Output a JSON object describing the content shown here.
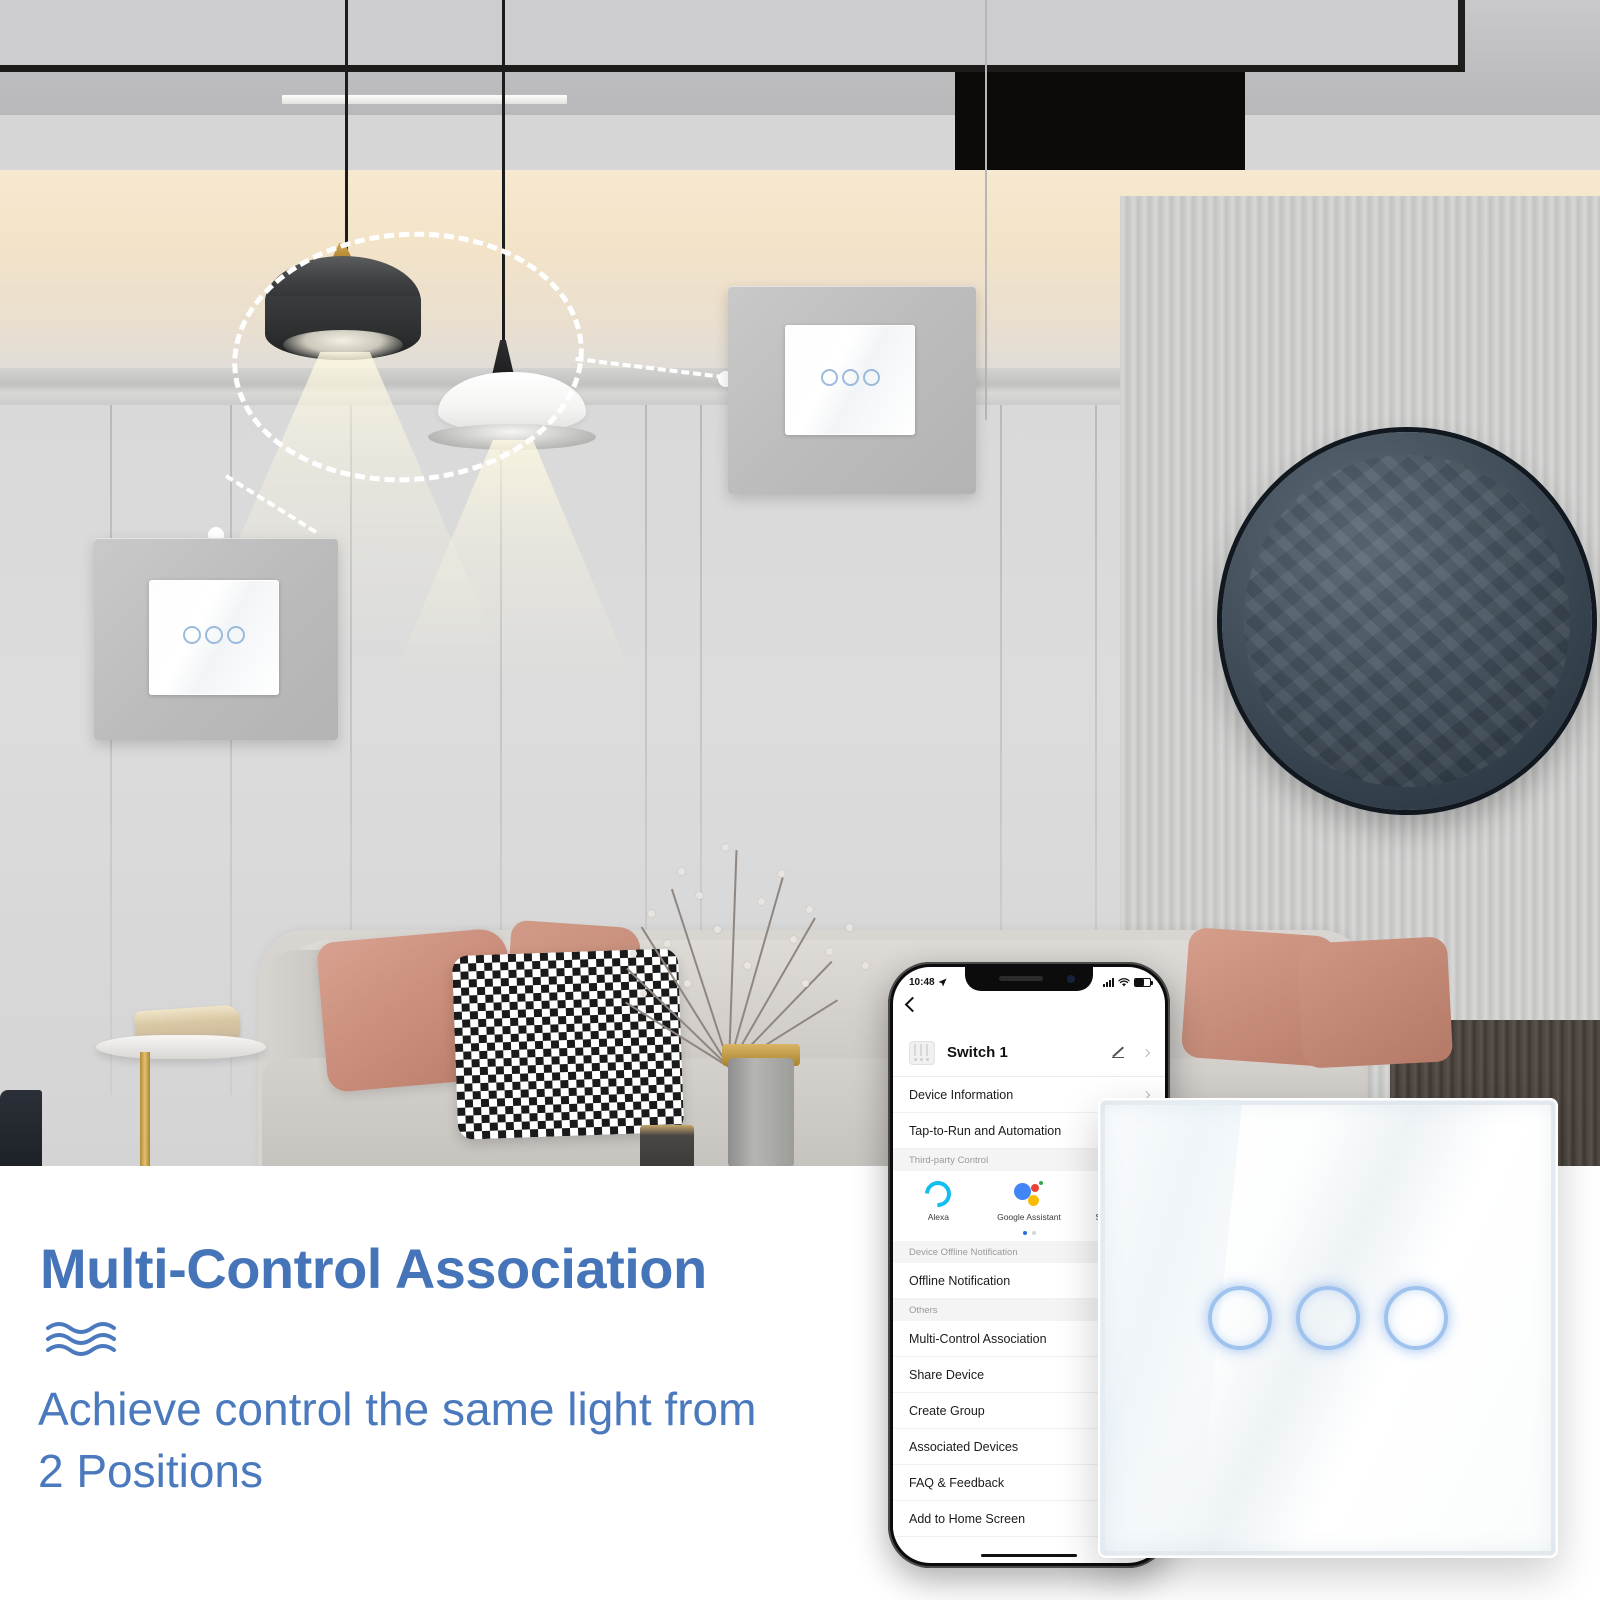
{
  "marketing": {
    "headline": "Multi-Control Association",
    "subline_1": "Achieve control the same light from",
    "subline_2": "2 Positions",
    "accent_color": "#4574b8",
    "sub_color": "#4b79bd",
    "divider_icon": "wave-lines-icon"
  },
  "phone": {
    "status": {
      "time": "10:48",
      "location_icon": "location-arrow-icon",
      "signal_icon": "cellular-bars-icon",
      "wifi_icon": "wifi-icon",
      "battery_icon": "battery-icon"
    },
    "nav": {
      "back_icon": "back-chevron-icon"
    },
    "device": {
      "icon": "switch-device-icon",
      "name": "Switch 1",
      "edit_icon": "pencil-icon",
      "chevron_icon": "chevron-right-icon"
    },
    "sections": [
      {
        "group_label": "",
        "rows": [
          {
            "label": "Device Information"
          },
          {
            "label": "Tap-to-Run and Automation"
          }
        ]
      },
      {
        "group_label": "Third-party Control",
        "rows": []
      },
      {
        "group_label": "Device Offline Notification",
        "rows": [
          {
            "label": "Offline Notification"
          }
        ]
      },
      {
        "group_label": "Others",
        "rows": [
          {
            "label": "Multi-Control Association"
          },
          {
            "label": "Share Device"
          },
          {
            "label": "Create Group"
          },
          {
            "label": "Associated Devices"
          },
          {
            "label": "FAQ & Feedback"
          },
          {
            "label": "Add to Home Screen"
          }
        ]
      }
    ],
    "third_party": [
      {
        "label": "Alexa",
        "icon": "alexa-icon",
        "color": "#12bdf0"
      },
      {
        "label": "Google Assistant",
        "icon": "google-assistant-icon",
        "color": "#4285f4"
      },
      {
        "label": "SmartThings",
        "icon": "smartthings-icon",
        "color": "#1a9fe0"
      }
    ],
    "carousel": {
      "pages": 2,
      "active": 1,
      "active_color": "#2a6fd6"
    }
  },
  "product": {
    "name": "glass-touch-switch-panel",
    "button_count": 3,
    "led_ring_color": "#9fc3ee",
    "panel_color": "#ffffff"
  },
  "scene": {
    "wall_switches": [
      {
        "name": "wall-switch-top-right",
        "buttons": 3
      },
      {
        "name": "wall-switch-bottom-left",
        "buttons": 3
      }
    ],
    "lamps": [
      {
        "name": "pendant-lamp-dark"
      },
      {
        "name": "pendant-lamp-white"
      }
    ],
    "annotation": {
      "ellipse": "dashed-highlight-ellipse",
      "connector_1": "dashed-connector-to-top-right-switch",
      "connector_2": "dashed-connector-to-bottom-left-switch"
    },
    "decor": [
      {
        "name": "circular-wall-art"
      },
      {
        "name": "sofa"
      },
      {
        "name": "houndstooth-pillow"
      },
      {
        "name": "rose-pillow"
      },
      {
        "name": "dried-branch-vase"
      },
      {
        "name": "marble-side-table"
      }
    ]
  }
}
